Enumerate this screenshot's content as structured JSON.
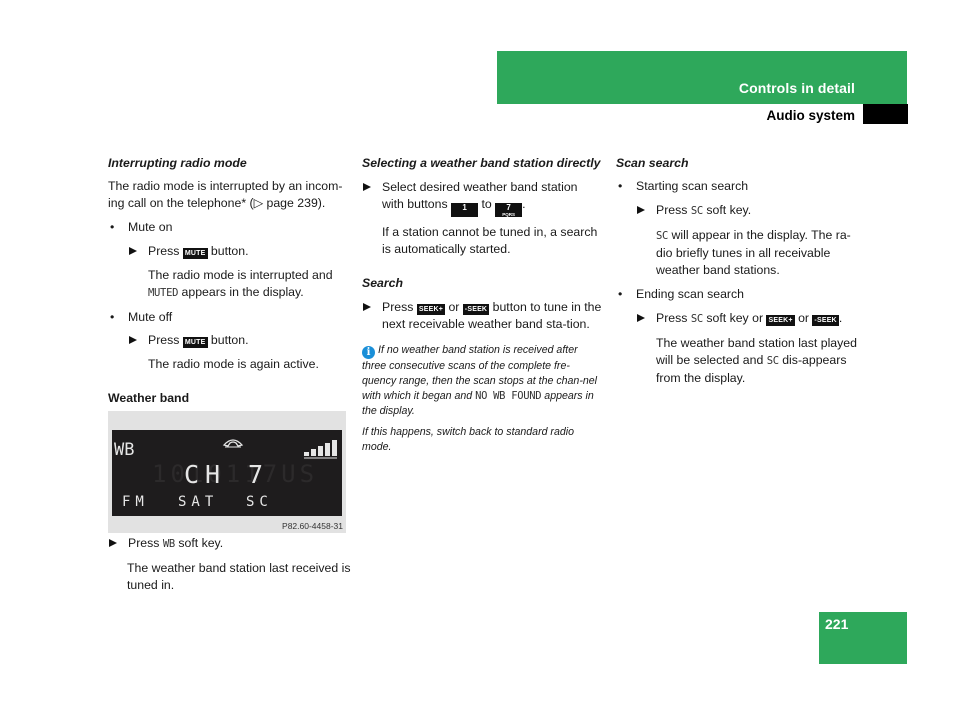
{
  "header": {
    "section": "Controls in detail",
    "subsection": "Audio system"
  },
  "page_number": "221",
  "left_column": {
    "interrupting": {
      "title": "Interrupting radio mode",
      "intro": "The radio mode is interrupted by an incom-ing call on the telephone* (▷ page 239).",
      "mute_on": {
        "bullet": "Mute on",
        "step_prefix": "Press",
        "key": "MUTE",
        "step_suffix": "button.",
        "result_1": "The radio mode is interrupted and",
        "result_mono": "MUTED",
        "result_2": "appears in the display."
      },
      "mute_off": {
        "bullet": "Mute off",
        "step_prefix": "Press",
        "key": "MUTE",
        "step_suffix": "button.",
        "result": "The radio mode is again active."
      }
    },
    "weather_band": {
      "title": "Weather band",
      "display": {
        "band": "WB",
        "channel_label": "CH",
        "channel_number": "7",
        "ghost_digits": "1010117US",
        "softkeys": [
          "FM",
          "SAT",
          "SC"
        ],
        "signal_bars": 5,
        "phone_icon": "phone-hangup-icon",
        "caption": "P82.60-4458-31"
      },
      "step_prefix": "Press",
      "step_mono": "WB",
      "step_suffix": "soft key.",
      "result": "The weather band station last received is tuned in."
    }
  },
  "middle_column": {
    "selecting": {
      "title": "Selecting a weather band station directly",
      "step_1": "Select desired weather band station with buttons",
      "key_from": "1",
      "key_to": "7",
      "key_to_sub": "PQRS",
      "step_to": "to",
      "result": "If a station cannot be tuned in, a search is automatically started."
    },
    "search": {
      "title": "Search",
      "step_prefix": "Press",
      "key_up": "SEEK+",
      "step_or": "or",
      "key_down": "-SEEK",
      "step_suffix": "button to tune in the next receivable weather band sta-tion."
    },
    "note": {
      "text_1": "If no weather band station is received after three consecutive scans of the complete fre-quency range, then the scan stops at the chan-nel with which it began and",
      "mono": "NO WB FOUND",
      "text_2": "appears in the display.",
      "text_3": "If this happens, switch back to standard radio mode."
    }
  },
  "right_column": {
    "title": "Scan search",
    "start": {
      "bullet": "Starting scan search",
      "step_prefix": "Press",
      "step_mono": "SC",
      "step_suffix": "soft key.",
      "result_mono": "SC",
      "result": "will appear in the display. The ra-dio briefly tunes in all receivable weather band stations."
    },
    "end": {
      "bullet": "Ending scan search",
      "step_prefix": "Press",
      "step_mono": "SC",
      "step_mid": "soft key or",
      "key_up": "SEEK+",
      "step_or": "or",
      "key_down": "-SEEK",
      "step_end": ".",
      "result_1": "The weather band station last played will be selected and",
      "result_mono": "SC",
      "result_2": "dis-appears from the display."
    }
  },
  "colors": {
    "accent_green": "#2ea85b",
    "info_blue": "#1a8fd8"
  }
}
